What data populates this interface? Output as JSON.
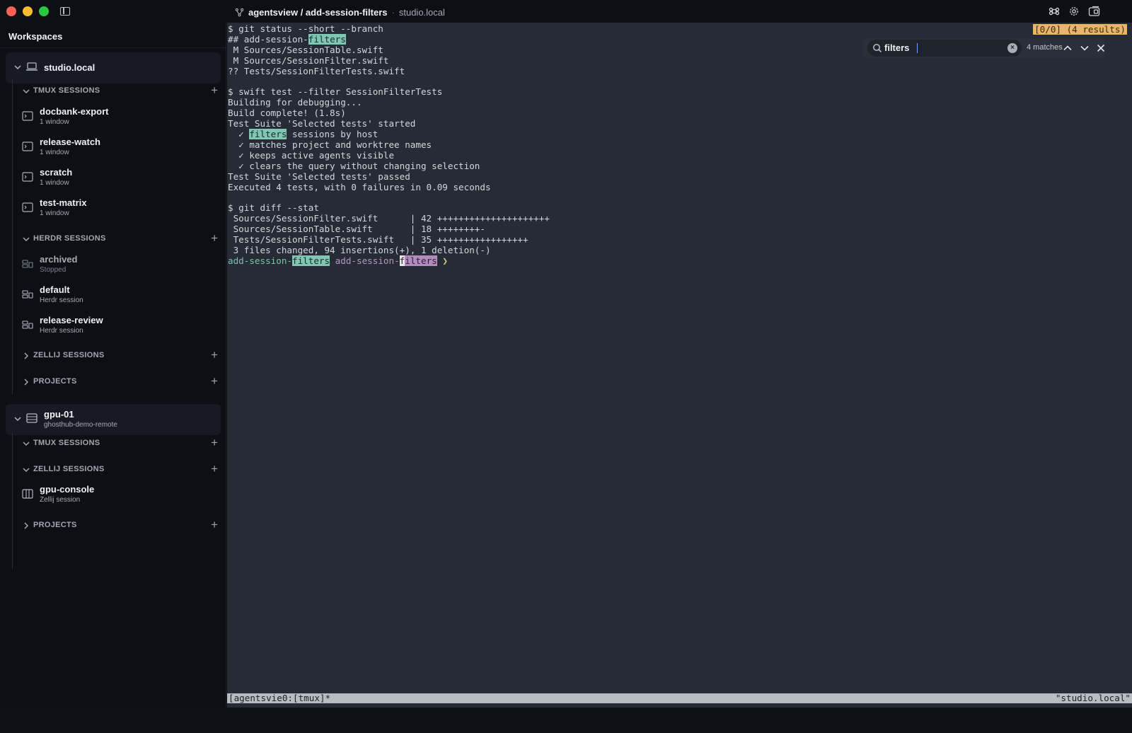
{
  "titlebar": {
    "title": "agentsview / add-session-filters",
    "separator": "·",
    "host": "studio.local",
    "right_icons": [
      "command-icon",
      "gear-icon",
      "panel-switch-icon"
    ]
  },
  "sidebar": {
    "title": "Workspaces",
    "hosts": [
      {
        "name": "studio.local",
        "subtitle": "",
        "sections": [
          {
            "label": "TMUX SESSIONS",
            "expanded": true,
            "items": [
              {
                "name": "docbank-export",
                "sub": "1 window"
              },
              {
                "name": "release-watch",
                "sub": "1 window"
              },
              {
                "name": "scratch",
                "sub": "1 window"
              },
              {
                "name": "test-matrix",
                "sub": "1 window"
              }
            ]
          },
          {
            "label": "HERDR SESSIONS",
            "expanded": true,
            "items": [
              {
                "name": "archived",
                "sub": "Stopped"
              },
              {
                "name": "default",
                "sub": "Herdr session"
              },
              {
                "name": "release-review",
                "sub": "Herdr session"
              }
            ]
          },
          {
            "label": "ZELLIJ SESSIONS",
            "expanded": false,
            "items": []
          },
          {
            "label": "PROJECTS",
            "expanded": false,
            "items": []
          }
        ]
      },
      {
        "name": "gpu-01",
        "subtitle": "ghosthub-demo-remote",
        "sections": [
          {
            "label": "TMUX SESSIONS",
            "expanded": true,
            "items": []
          },
          {
            "label": "ZELLIJ SESSIONS",
            "expanded": true,
            "items": [
              {
                "name": "gpu-console",
                "sub": "Zellij session"
              }
            ]
          },
          {
            "label": "PROJECTS",
            "expanded": false,
            "items": []
          }
        ]
      }
    ]
  },
  "terminal": {
    "lines": {
      "l1": "$ git status --short --branch",
      "l2a": "## add-session-",
      "l2b": "filters",
      "l3": " M Sources/SessionTable.swift",
      "l4": " M Sources/SessionFilter.swift",
      "l5": "?? Tests/SessionFilterTests.swift",
      "l6": "",
      "l7": "$ swift test --filter SessionFilterTests",
      "l8": "Building for debugging...",
      "l9": "Build complete! (1.8s)",
      "l10": "Test Suite 'Selected tests' started",
      "l11a": "  ✓ ",
      "l11b": "filters",
      "l11c": " sessions by host",
      "l12": "  ✓ matches project and worktree names",
      "l13": "  ✓ keeps active agents visible",
      "l14": "  ✓ clears the query without changing selection",
      "l15": "Test Suite 'Selected tests' passed",
      "l16": "Executed 4 tests, with 0 failures in 0.09 seconds",
      "l17": "",
      "l18": "$ git diff --stat",
      "l19": " Sources/SessionFilter.swift      | 42 +++++++++++++++++++++",
      "l20": " Sources/SessionTable.swift       | 18 ++++++++-",
      "l21": " Tests/SessionFilterTests.swift   | 35 +++++++++++++++++",
      "l22": " 3 files changed, 94 insertions(+), 1 deletion(-)",
      "p1": "add-session-",
      "p2": "filters",
      "p3": " add-session-",
      "p4": "f",
      "p5": "ilters",
      "p6": " ❯"
    },
    "result_badge": "[0/0] (4 results)",
    "status_left": "[agentsvie0:[tmux]*",
    "status_right": "\"studio.local\""
  },
  "find": {
    "query": "filters",
    "count": "4 matches",
    "clear_glyph": "×"
  },
  "colors": {
    "match_highlight": "#7fc7b3",
    "current_match": "#b38cbf",
    "result_badge": "#e9b56b",
    "terminal_bg": "#272b35",
    "sidebar_bg": "#0d0f15"
  }
}
